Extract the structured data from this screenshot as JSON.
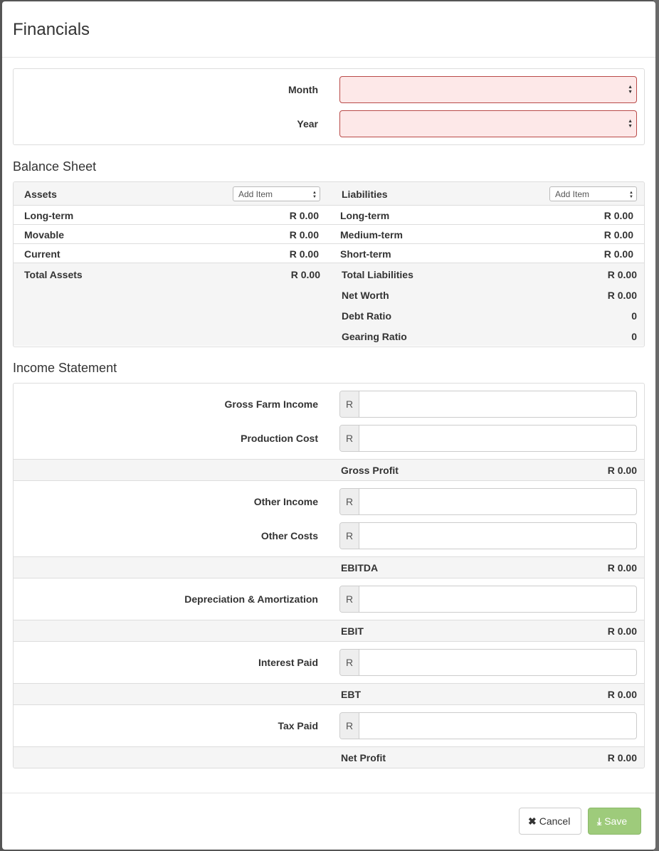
{
  "modal": {
    "title": "Financials"
  },
  "period": {
    "month_label": "Month",
    "year_label": "Year",
    "month_value": "",
    "year_value": ""
  },
  "balance_sheet": {
    "title": "Balance Sheet",
    "assets_header": "Assets",
    "liabilities_header": "Liabilities",
    "add_item_label": "Add Item",
    "assets": [
      {
        "label": "Long-term",
        "value": "R 0.00"
      },
      {
        "label": "Movable",
        "value": "R 0.00"
      },
      {
        "label": "Current",
        "value": "R 0.00"
      }
    ],
    "liabilities": [
      {
        "label": "Long-term",
        "value": "R 0.00"
      },
      {
        "label": "Medium-term",
        "value": "R 0.00"
      },
      {
        "label": "Short-term",
        "value": "R 0.00"
      }
    ],
    "total_assets": {
      "label": "Total Assets",
      "value": "R 0.00"
    },
    "summary": [
      {
        "label": "Total Liabilities",
        "value": "R 0.00"
      },
      {
        "label": "Net Worth",
        "value": "R 0.00"
      },
      {
        "label": "Debt Ratio",
        "value": "0"
      },
      {
        "label": "Gearing Ratio",
        "value": "0"
      }
    ]
  },
  "income_statement": {
    "title": "Income Statement",
    "currency_prefix": "R",
    "gross_farm_income": {
      "label": "Gross Farm Income",
      "value": ""
    },
    "production_cost": {
      "label": "Production Cost",
      "value": ""
    },
    "gross_profit": {
      "label": "Gross Profit",
      "value": "R 0.00"
    },
    "other_income": {
      "label": "Other Income",
      "value": ""
    },
    "other_costs": {
      "label": "Other Costs",
      "value": ""
    },
    "ebitda": {
      "label": "EBITDA",
      "value": "R 0.00"
    },
    "depreciation": {
      "label": "Depreciation & Amortization",
      "value": ""
    },
    "ebit": {
      "label": "EBIT",
      "value": "R 0.00"
    },
    "interest_paid": {
      "label": "Interest Paid",
      "value": ""
    },
    "ebt": {
      "label": "EBT",
      "value": "R 0.00"
    },
    "tax_paid": {
      "label": "Tax Paid",
      "value": ""
    },
    "net_profit": {
      "label": "Net Profit",
      "value": "R 0.00"
    }
  },
  "footer": {
    "cancel_label": "Cancel",
    "save_label": "Save",
    "cancel_icon": "close-icon",
    "save_icon": "download-icon"
  },
  "colors": {
    "invalid_background": "#fde8e8",
    "invalid_border": "#b94a48",
    "save_button": "#9ecb7b"
  }
}
